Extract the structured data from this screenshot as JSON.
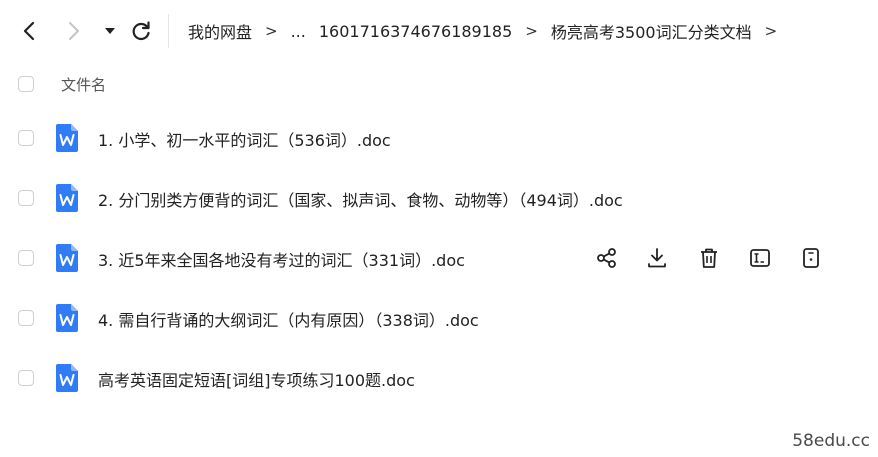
{
  "toolbar": {
    "back_icon": "chevron-left-icon",
    "forward_icon": "chevron-right-icon",
    "dropdown_icon": "caret-down-icon",
    "refresh_icon": "refresh-icon"
  },
  "breadcrumb": {
    "items": [
      "我的网盘",
      "...",
      "1601716374676189185",
      "杨亮高考3500词汇分类文档"
    ],
    "separator": ">"
  },
  "list": {
    "column_name": "文件名",
    "files": [
      {
        "name": "1. 小学、初一水平的词汇（536词）.doc",
        "icon": "word-doc-icon"
      },
      {
        "name": "2. 分门别类方便背的词汇（国家、拟声词、食物、动物等）（494词）.doc",
        "icon": "word-doc-icon"
      },
      {
        "name": "3. 近5年来全国各地没有考过的词汇（331词）.doc",
        "icon": "word-doc-icon"
      },
      {
        "name": "4. 需自行背诵的大纲词汇（内有原因）（338词）.doc",
        "icon": "word-doc-icon"
      },
      {
        "name": "高考英语固定短语[词组]专项练习100题.doc",
        "icon": "word-doc-icon"
      }
    ],
    "hovered_row_actions": [
      "share-icon",
      "download-icon",
      "delete-icon",
      "rename-icon",
      "more-icon"
    ]
  },
  "colors": {
    "doc_icon": "#2f7cf6",
    "checkbox_border": "#cfcfcf",
    "text": "#222222"
  },
  "watermark": "58edu.cc"
}
